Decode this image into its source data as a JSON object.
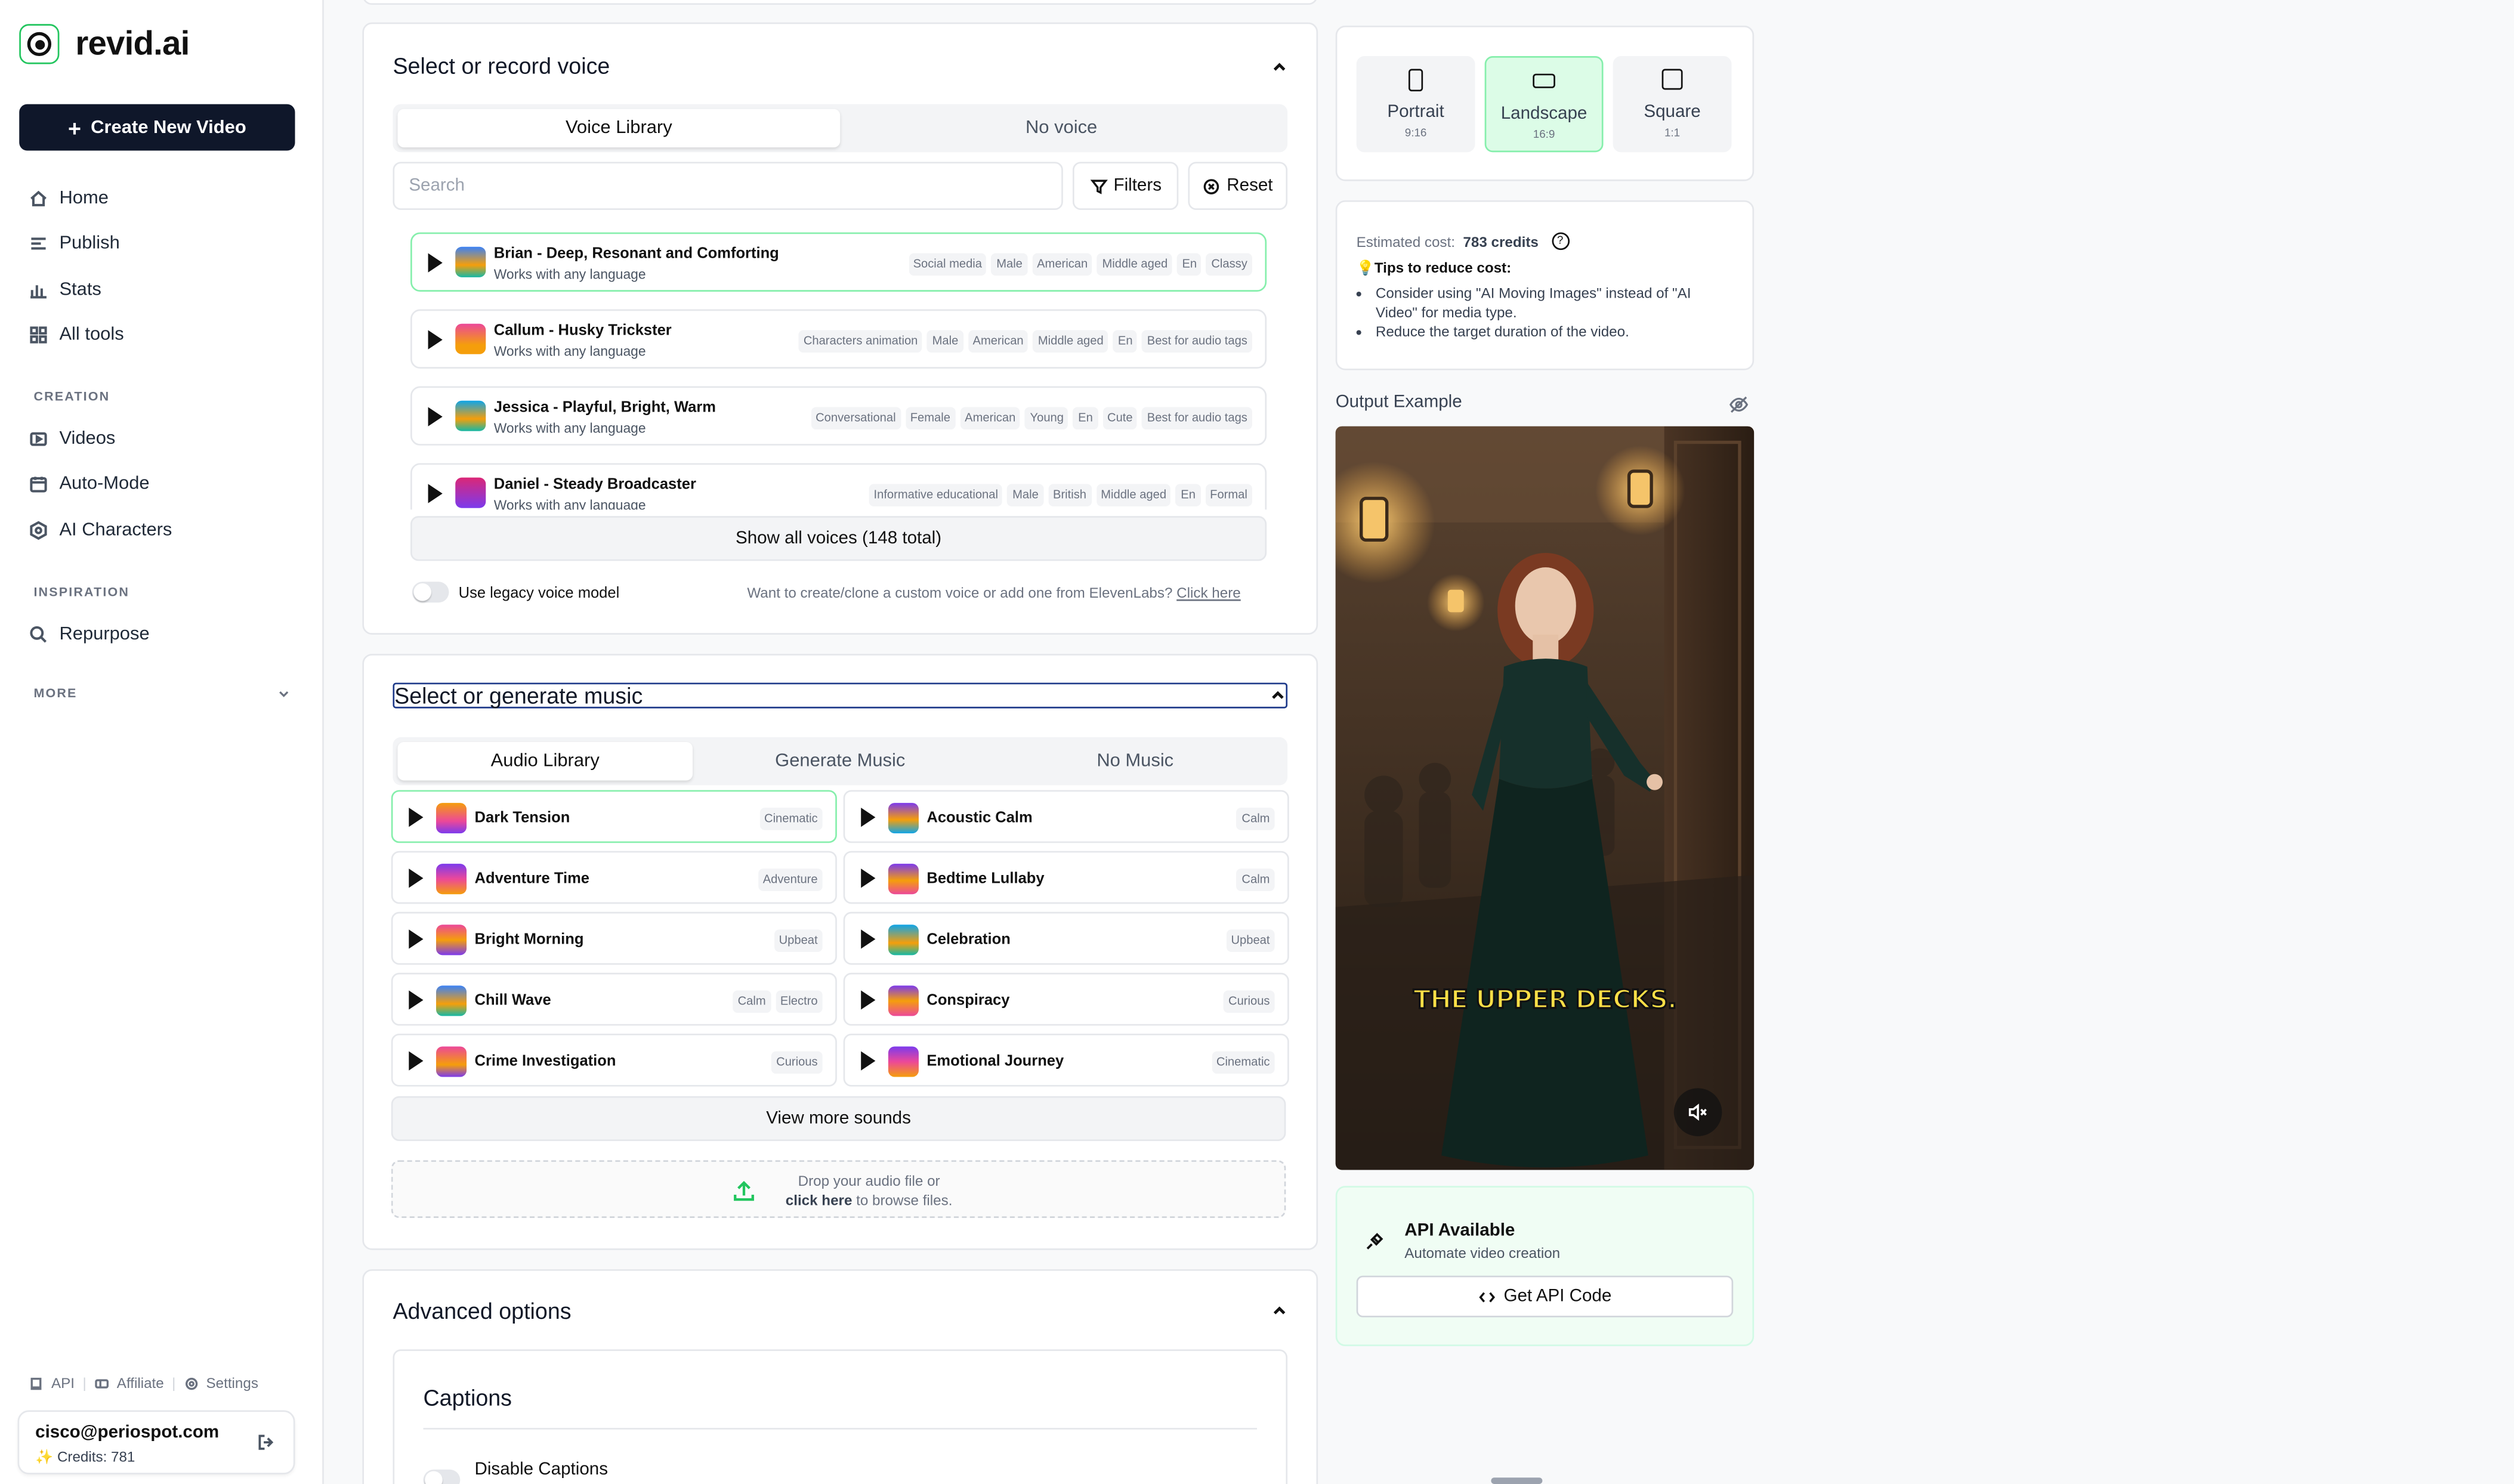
{
  "app": {
    "name": "revid.ai"
  },
  "sidebar": {
    "create_button": "Create New Video",
    "nav_main": [
      {
        "label": "Home",
        "icon": "home-icon"
      },
      {
        "label": "Publish",
        "icon": "publish-icon"
      },
      {
        "label": "Stats",
        "icon": "stats-icon"
      },
      {
        "label": "All tools",
        "icon": "grid-icon"
      }
    ],
    "section_creation": "CREATION",
    "nav_creation": [
      {
        "label": "Videos",
        "icon": "video-icon"
      },
      {
        "label": "Auto-Mode",
        "icon": "calendar-icon"
      },
      {
        "label": "AI Characters",
        "icon": "character-icon"
      }
    ],
    "section_inspiration": "INSPIRATION",
    "nav_inspiration": [
      {
        "label": "Repurpose",
        "icon": "search-icon"
      }
    ],
    "section_more": "MORE",
    "footer_links": {
      "api": "API",
      "affiliate": "Affiliate",
      "settings": "Settings"
    },
    "user": {
      "email": "cisco@periospot.com",
      "credits": "✨ Credits: 781"
    }
  },
  "voice": {
    "title": "Select or record voice",
    "tabs": [
      "Voice Library",
      "No voice"
    ],
    "search_placeholder": "Search",
    "filters_label": "Filters",
    "reset_label": "Reset",
    "items": [
      {
        "name": "Brian - Deep, Resonant and Comforting",
        "sub": "Works with any language",
        "tags": [
          "Social media",
          "Male",
          "American",
          "Middle aged",
          "En",
          "Classy"
        ],
        "selected": true
      },
      {
        "name": "Callum - Husky Trickster",
        "sub": "Works with any language",
        "tags": [
          "Characters animation",
          "Male",
          "American",
          "Middle aged",
          "En",
          "Best for audio tags"
        ],
        "selected": false
      },
      {
        "name": "Jessica - Playful, Bright, Warm",
        "sub": "Works with any language",
        "tags": [
          "Conversational",
          "Female",
          "American",
          "Young",
          "En",
          "Cute",
          "Best for audio tags"
        ],
        "selected": false
      },
      {
        "name": "Daniel - Steady Broadcaster",
        "sub": "Works with any language",
        "tags": [
          "Informative educational",
          "Male",
          "British",
          "Middle aged",
          "En",
          "Formal"
        ],
        "selected": false
      }
    ],
    "show_all_label": "Show all voices (148 total)",
    "legacy_label": "Use legacy voice model",
    "custom_prompt": "Want to create/clone a custom voice or add one from ElevenLabs?",
    "custom_link": "Click here"
  },
  "music": {
    "title": "Select or generate music",
    "tabs": [
      "Audio Library",
      "Generate Music",
      "No Music"
    ],
    "items": [
      {
        "name": "Dark Tension",
        "tags": [
          "Cinematic"
        ],
        "selected": true
      },
      {
        "name": "Acoustic Calm",
        "tags": [
          "Calm"
        ],
        "selected": false
      },
      {
        "name": "Adventure Time",
        "tags": [
          "Adventure"
        ],
        "selected": false
      },
      {
        "name": "Bedtime Lullaby",
        "tags": [
          "Calm"
        ],
        "selected": false
      },
      {
        "name": "Bright Morning",
        "tags": [
          "Upbeat"
        ],
        "selected": false
      },
      {
        "name": "Celebration",
        "tags": [
          "Upbeat"
        ],
        "selected": false
      },
      {
        "name": "Chill Wave",
        "tags": [
          "Calm",
          "Electro"
        ],
        "selected": false
      },
      {
        "name": "Conspiracy",
        "tags": [
          "Curious"
        ],
        "selected": false
      },
      {
        "name": "Crime Investigation",
        "tags": [
          "Curious"
        ],
        "selected": false
      },
      {
        "name": "Emotional Journey",
        "tags": [
          "Cinematic"
        ],
        "selected": false
      }
    ],
    "view_more_label": "View more sounds",
    "drop_line1": "Drop your audio file or",
    "drop_link": "click here",
    "drop_line2": " to browse files."
  },
  "advanced": {
    "title": "Advanced options",
    "captions_title": "Captions",
    "disable_captions": "Disable Captions"
  },
  "aspect": {
    "options": [
      {
        "label": "Portrait",
        "ratio": "9:16",
        "active": false
      },
      {
        "label": "Landscape",
        "ratio": "16:9",
        "active": true
      },
      {
        "label": "Square",
        "ratio": "1:1",
        "active": false
      }
    ]
  },
  "cost": {
    "label": "Estimated cost:",
    "value": "783 credits",
    "tips_title": "Tips to reduce cost:",
    "tips": [
      "Consider using \"AI Moving Images\" instead of \"AI Video\" for media type.",
      "Reduce the target duration of the video."
    ]
  },
  "output": {
    "label": "Output Example",
    "caption": "THE UPPER DECKS."
  },
  "api": {
    "title": "API Available",
    "subtitle": "Automate video creation",
    "button": "Get API Code"
  },
  "colors": {
    "accent_green": "#22c55e",
    "selected_border": "#86efac",
    "primary_dark": "#0f172a",
    "focus_outline": "#1e3a8a"
  }
}
